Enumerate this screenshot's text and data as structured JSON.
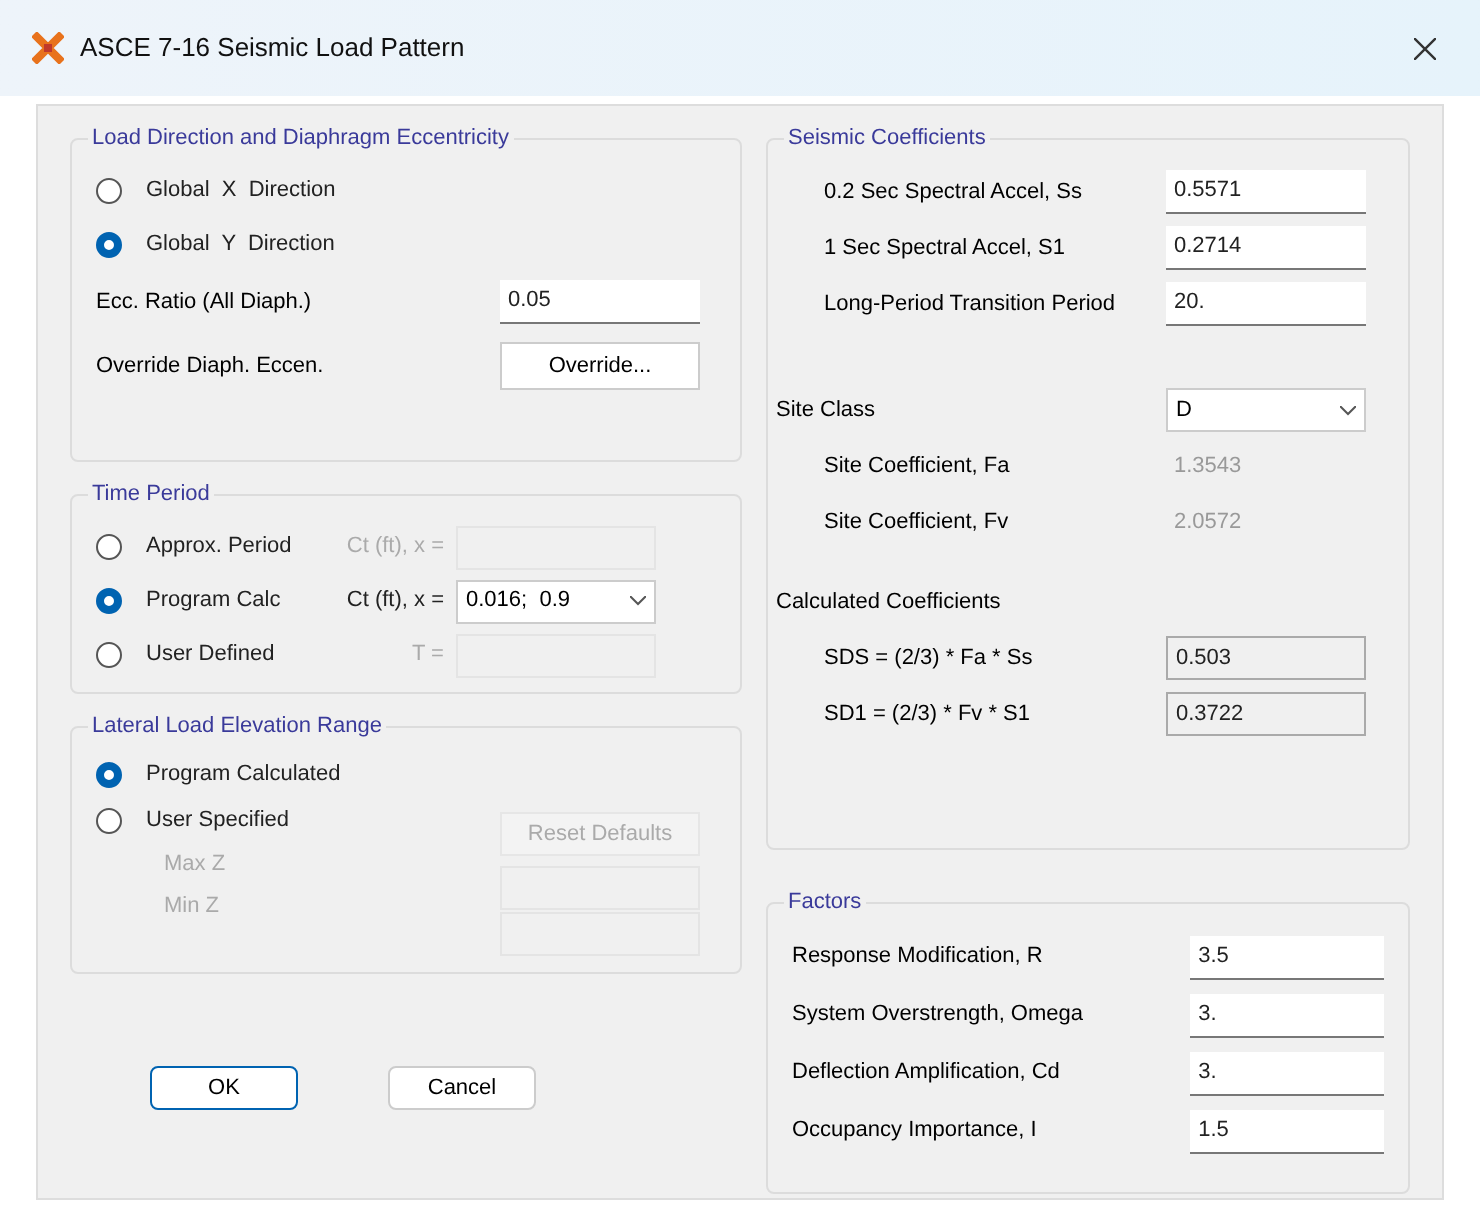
{
  "window": {
    "title": "ASCE 7-16 Seismic Load Pattern"
  },
  "load_direction": {
    "title": "Load Direction and Diaphragm Eccentricity",
    "options": [
      {
        "label": "Global  X  Direction",
        "selected": false
      },
      {
        "label": "Global  Y  Direction",
        "selected": true
      }
    ],
    "ecc_ratio": {
      "label": "Ecc. Ratio (All Diaph.)",
      "value": "0.05"
    },
    "override": {
      "label": "Override Diaph. Eccen.",
      "button": "Override..."
    }
  },
  "time_period": {
    "title": "Time Period",
    "options": [
      {
        "label": "Approx. Period",
        "selected": false,
        "field_label": "Ct (ft), x =",
        "kind": "field",
        "disabled": true
      },
      {
        "label": "Program Calc",
        "selected": true,
        "field_label": "Ct (ft), x =",
        "kind": "dropdown",
        "value": "0.016;  0.9",
        "disabled": false
      },
      {
        "label": "User Defined",
        "selected": false,
        "field_label": "T =",
        "kind": "field",
        "disabled": true
      }
    ]
  },
  "lateral_range": {
    "title": "Lateral Load Elevation Range",
    "options": [
      {
        "label": "Program Calculated",
        "selected": true
      },
      {
        "label": "User Specified",
        "selected": false
      }
    ],
    "reset_button": {
      "label": "Reset Defaults",
      "disabled": true
    },
    "fields": [
      {
        "label": "Max Z",
        "disabled": true
      },
      {
        "label": "Min Z",
        "disabled": true
      }
    ]
  },
  "buttons": [
    {
      "label": "OK",
      "default": true
    },
    {
      "label": "Cancel",
      "default": false
    }
  ],
  "seismic_coefficients": {
    "title": "Seismic Coefficients",
    "fields": [
      {
        "label": "0.2 Sec Spectral Accel, Ss",
        "value": "0.5571"
      },
      {
        "label": "1 Sec Spectral Accel, S1",
        "value": "0.2714"
      },
      {
        "label": "Long-Period Transition Period",
        "value": "20."
      }
    ]
  },
  "site_class": {
    "label": "Site Class",
    "value": "D"
  },
  "site_coefficients": [
    {
      "label": "Site Coefficient, Fa",
      "value": "1.3543"
    },
    {
      "label": "Site Coefficient, Fv",
      "value": "2.0572"
    }
  ],
  "calculated": {
    "title": "Calculated Coefficients",
    "fields": [
      {
        "label": "SDS = (2/3) * Fa * Ss",
        "value": "0.503"
      },
      {
        "label": "SD1 = (2/3) * Fv * S1",
        "value": "0.3722"
      }
    ]
  },
  "factors": {
    "title": "Factors",
    "fields": [
      {
        "label": "Response Modification, R",
        "value": "3.5"
      },
      {
        "label": "System Overstrength, Omega",
        "value": "3."
      },
      {
        "label": "Deflection Amplification, Cd",
        "value": "3."
      },
      {
        "label": "Occupancy Importance, I",
        "value": "1.5"
      }
    ]
  }
}
